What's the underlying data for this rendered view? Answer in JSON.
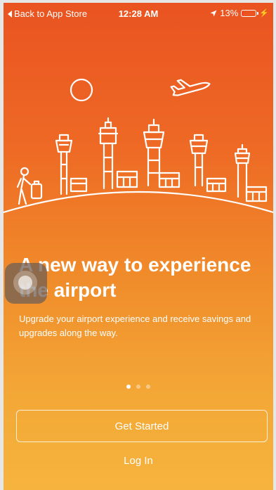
{
  "status_bar": {
    "back_label": "Back to App Store",
    "time": "12:28 AM",
    "battery_percent": "13%",
    "battery_level": 0.13,
    "battery_color": "#ff3b30",
    "icons": [
      "back-triangle-icon",
      "location-arrow-icon",
      "battery-icon",
      "charging-bolt-icon"
    ]
  },
  "onboarding": {
    "headline": "A new way to experience the airport",
    "subtext": "Upgrade your airport experience and receive savings and upgrades along the way.",
    "pager": {
      "count": 3,
      "active_index": 0
    }
  },
  "actions": {
    "get_started": "Get Started",
    "log_in": "Log In"
  },
  "colors": {
    "gradient_top": "#ea5321",
    "gradient_bottom": "#f6b43e",
    "foreground": "#ffffff"
  },
  "illustration_icons": [
    "sun-icon",
    "airplane-icon",
    "control-tower-icon",
    "traveler-icon",
    "terminal-building-icon"
  ]
}
